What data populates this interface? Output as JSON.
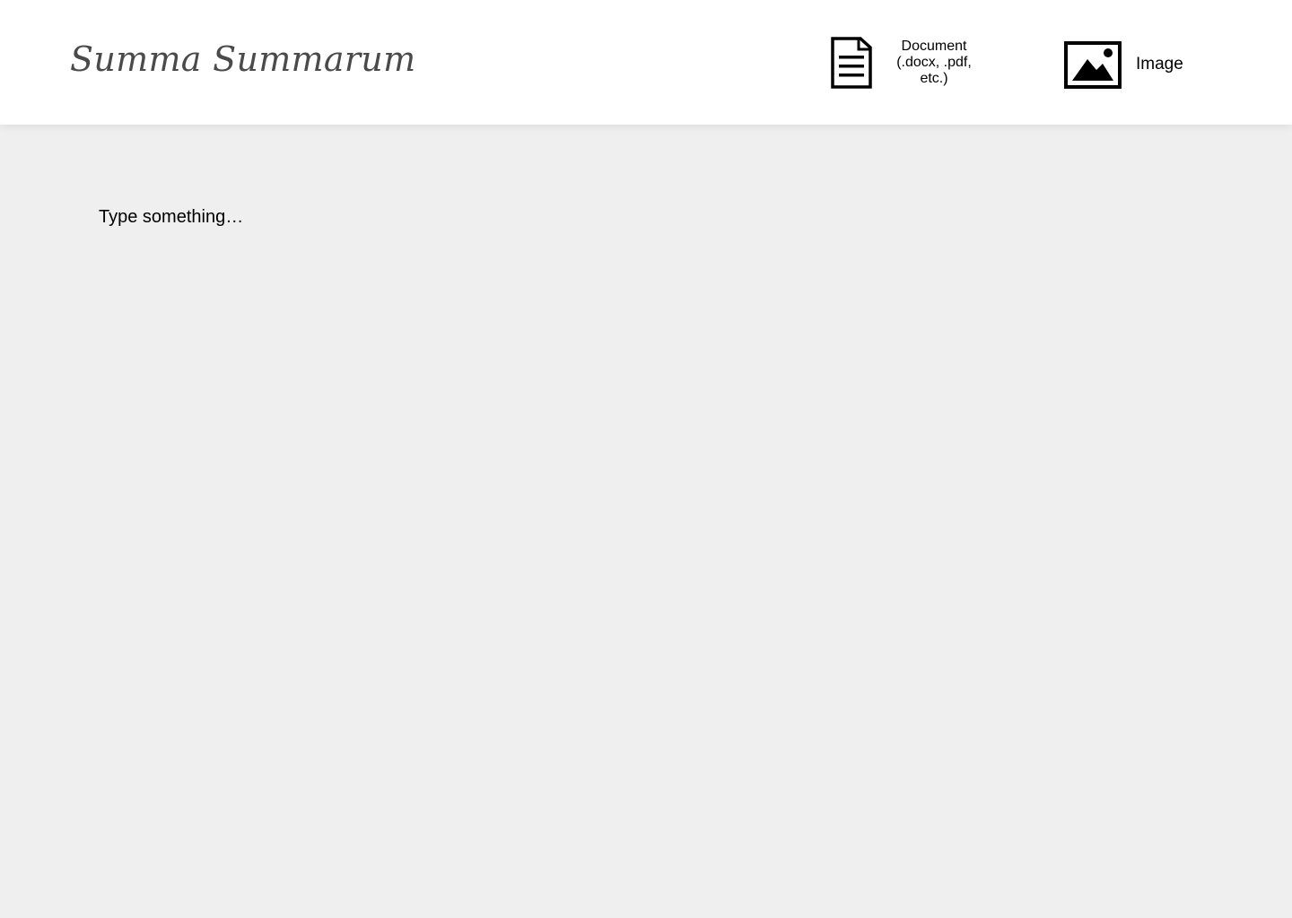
{
  "header": {
    "brand": "Summa Summarum",
    "upload_document": {
      "label": "Document (.docx, .pdf, etc.)",
      "icon": "document-icon"
    },
    "upload_image": {
      "label": "Image",
      "icon": "image-icon"
    }
  },
  "editor": {
    "value": "",
    "placeholder": "Type something…"
  }
}
